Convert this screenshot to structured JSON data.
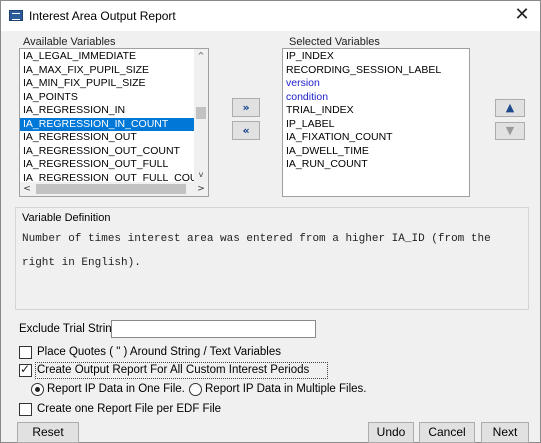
{
  "window": {
    "title": "Interest Area Output Report",
    "close_glyph": "✕",
    "app_icon": "app-icon"
  },
  "available": {
    "label": "Available Variables",
    "items": [
      "IA_LEGAL_IMMEDIATE",
      "IA_MAX_FIX_PUPIL_SIZE",
      "IA_MIN_FIX_PUPIL_SIZE",
      "IA_POINTS",
      "IA_REGRESSION_IN",
      "IA_REGRESSION_IN_COUNT",
      "IA_REGRESSION_OUT",
      "IA_REGRESSION_OUT_COUNT",
      "IA_REGRESSION_OUT_FULL",
      "IA_REGRESSION_OUT_FULL_COUNT"
    ],
    "selected_index": 5
  },
  "selected": {
    "label": "Selected Variables",
    "items": [
      "IP_INDEX",
      "RECORDING_SESSION_LABEL",
      "version",
      "condition",
      "TRIAL_INDEX",
      "IP_LABEL",
      "IA_FIXATION_COUNT",
      "IA_DWELL_TIME",
      "IA_RUN_COUNT"
    ],
    "blue_items": [
      "version",
      "condition"
    ]
  },
  "move_buttons": {
    "add": "»",
    "remove": "«"
  },
  "order_buttons": {
    "up": "▲",
    "down": "▼"
  },
  "definition": {
    "label": "Variable Definition",
    "text": "Number of times interest area was entered from a higher IA_ID (from the right in English)."
  },
  "exclude": {
    "label": "Exclude Trial String :",
    "value": ""
  },
  "options": {
    "quotes_label": "Place Quotes ( \" ) Around String / Text Variables",
    "quotes_checked": false,
    "custom_periods_label": "Create Output Report For All Custom Interest Periods",
    "custom_periods_checked": true,
    "radio_one_file": "Report IP Data in One File.",
    "radio_multiple_files": "Report IP Data in Multiple Files.",
    "radio_selected": "one",
    "per_edf_label": "Create one Report File per EDF File",
    "per_edf_checked": false
  },
  "footer": {
    "reset": "Reset",
    "undo": "Undo",
    "cancel": "Cancel",
    "next": "Next"
  },
  "colors": {
    "selection": "#0078d7",
    "custom_variable": "#1f22c8",
    "dialog_bg": "#f0f0f0"
  }
}
